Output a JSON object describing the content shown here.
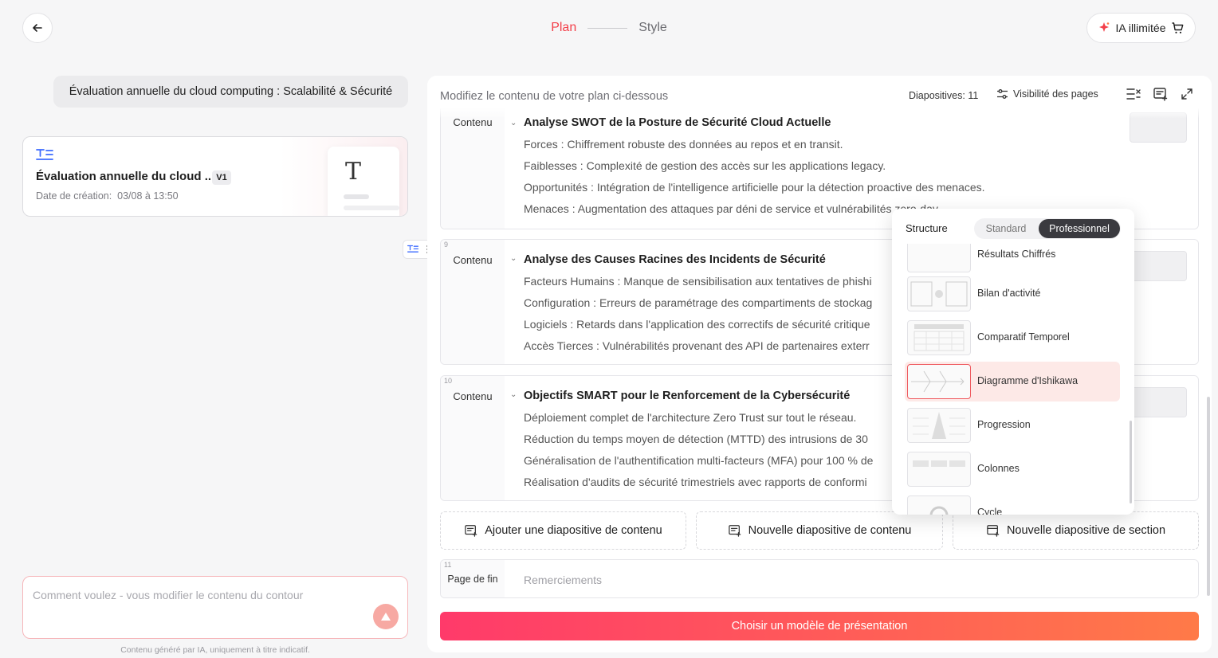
{
  "header": {
    "steps": [
      "Plan",
      "Style"
    ],
    "ia_label": "IA illimitée"
  },
  "left": {
    "topic": "Évaluation annuelle du cloud computing : Scalabilité & Sécurité",
    "doc": {
      "title": "Évaluation annuelle du cloud ...",
      "version": "V1",
      "date_label": "Date de création:",
      "date_value": "03/08 à 13:50",
      "thumb_letter": "T"
    },
    "prompt_placeholder": "Comment voulez - vous modifier le contenu du contour",
    "disclaimer": "Contenu généré par IA, uniquement à titre indicatif."
  },
  "panel": {
    "hint": "Modifiez le contenu de votre plan ci-dessous",
    "slides_count_label": "Diapositives: 11",
    "visibility_label": "Visibilité des pages",
    "slides": [
      {
        "num": "",
        "type": "Contenu",
        "title": "Analyse SWOT de la Posture de Sécurité Cloud Actuelle",
        "lines": [
          "Forces : Chiffrement robuste des données au repos et en transit.",
          "Faiblesses : Complexité de gestion des accès sur les applications legacy.",
          "Opportunités : Intégration de l'intelligence artificielle pour la détection proactive des menaces.",
          "Menaces : Augmentation des attaques par déni de service et vulnérabilités zero-day."
        ]
      },
      {
        "num": "9",
        "type": "Contenu",
        "title": "Analyse des Causes Racines des Incidents de Sécurité",
        "lines": [
          "Facteurs Humains : Manque de sensibilisation aux tentatives de phishi",
          "Configuration : Erreurs de paramétrage des compartiments de stockag",
          "Logiciels : Retards dans l'application des correctifs de sécurité critique",
          "Accès Tierces : Vulnérabilités provenant des API de partenaires exterr"
        ]
      },
      {
        "num": "10",
        "type": "Contenu",
        "title": "Objectifs SMART pour le Renforcement de la Cybersécurité",
        "lines": [
          "Déploiement complet de l'architecture Zero Trust sur tout le réseau.",
          "Réduction du temps moyen de détection (MTTD) des intrusions de 30",
          "Généralisation de l'authentification multi-facteurs (MFA) pour 100 % de",
          "Réalisation d'audits de sécurité trimestriels avec rapports de conformi"
        ]
      }
    ],
    "add_buttons": [
      "Ajouter une diapositive de contenu",
      "Nouvelle diapositive de contenu",
      "Nouvelle diapositive de section"
    ],
    "end_slide": {
      "num": "11",
      "type": "Page de fin",
      "title": "Remerciements"
    },
    "cta": "Choisir un modèle de présentation"
  },
  "popup": {
    "label": "Structure",
    "tabs": [
      "Standard",
      "Professionnel"
    ],
    "options": [
      "Résultats Chiffrés",
      "Bilan d'activité",
      "Comparatif Temporel",
      "Diagramme d'Ishikawa",
      "Progression",
      "Colonnes",
      "Cycle"
    ],
    "selected": "Diagramme d'Ishikawa"
  },
  "colors": {
    "accent": "#f3404a",
    "cta_start": "#ff3a6a",
    "cta_end": "#ff7a48"
  }
}
